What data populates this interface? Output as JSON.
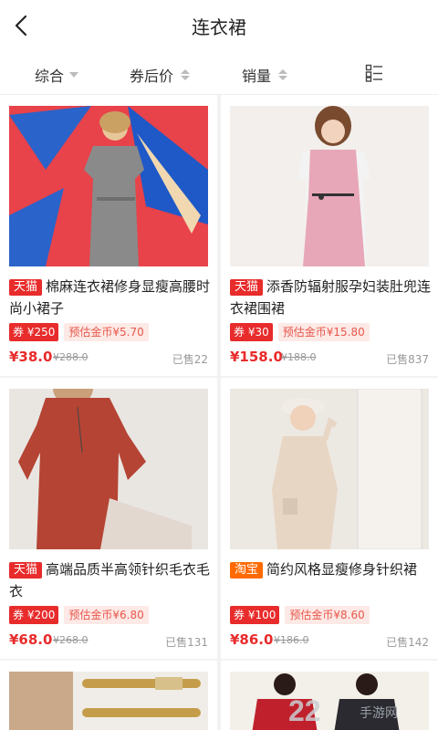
{
  "header": {
    "title": "连衣裙"
  },
  "filters": {
    "comprehensive": "综合",
    "after_coupon_price": "券后价",
    "sales": "销量"
  },
  "products": [
    {
      "platform": "天猫",
      "name": "棉麻连衣裙修身显瘦高腰时尚小裙子",
      "coupon": "券 ¥250",
      "coins": "预估金币¥5.70",
      "price": "¥38.0",
      "original": "¥288.0",
      "sold": "已售22"
    },
    {
      "platform": "天猫",
      "name": "添香防辐射服孕妇装肚兜连衣裙围裙",
      "coupon": "券 ¥30",
      "coins": "预估金币¥15.80",
      "price": "¥158.0",
      "original": "¥188.0",
      "sold": "已售837"
    },
    {
      "platform": "天猫",
      "name": "高端品质半高领针织毛衣毛衣",
      "coupon": "券 ¥200",
      "coins": "预估金币¥6.80",
      "price": "¥68.0",
      "original": "¥268.0",
      "sold": "已售131"
    },
    {
      "platform": "淘宝",
      "name": "简约风格显瘦修身针织裙",
      "coupon": "券 ¥100",
      "coins": "预估金币¥8.60",
      "price": "¥86.0",
      "original": "¥186.0",
      "sold": "已售142"
    }
  ],
  "watermark": {
    "number": "22",
    "text": "手游网"
  },
  "colors": {
    "accent": "#e82b2b",
    "taobao": "#ff6a00"
  }
}
